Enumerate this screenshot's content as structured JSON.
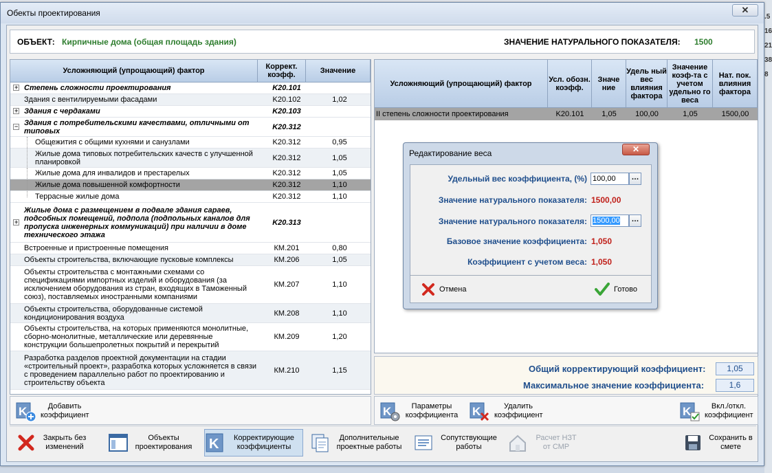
{
  "window": {
    "title": "Обекты проектирования"
  },
  "objhdr": {
    "obj_label": "ОБЪЕКТ:",
    "obj_value": "Кирпичные дома (общая площадь здания)",
    "nat_label": "ЗНАЧЕНИЕ НАТУРАЛЬНОГО ПОКАЗАТЕЛЯ:",
    "nat_value": "1500"
  },
  "left_table": {
    "headers": [
      "Усложняющий (упрощающий) фактор",
      "Коррект. коэфф.",
      "Значение"
    ],
    "rows": [
      {
        "name": "Степень сложности проектирования",
        "code": "K20.101",
        "value": ""
      },
      {
        "name": "Здания с вентилируемыми фасадами",
        "code": "K20.102",
        "value": "1,02"
      },
      {
        "name": "Здания с чердаками",
        "code": "K20.103",
        "value": ""
      },
      {
        "name": "Здания с потребительскими качествами, отличными от типовых",
        "code": "K20.312",
        "value": ""
      },
      {
        "name": "Общежития с общими кухнями и санузлами",
        "code": "K20.312",
        "value": "0,95"
      },
      {
        "name": "Жилые дома типовых потребительских качеств с улучшенной планировкой",
        "code": "K20.312",
        "value": "1,05"
      },
      {
        "name": "Жилые дома для инвалидов и престарелых",
        "code": "K20.312",
        "value": "1,05"
      },
      {
        "name": "Жилые дома повышенной комфортности",
        "code": "K20.312",
        "value": "1,10"
      },
      {
        "name": "Террасные жилые дома",
        "code": "K20.312",
        "value": "1,10"
      },
      {
        "name": "Жилые дома с размещением в подвале здания сараев, подсобных помещений, подпола (подпольных каналов для пропуска инженерных коммуникаций) при наличии в доме технического этажа",
        "code": "K20.313",
        "value": ""
      },
      {
        "name": "Встроенные и пристроенные помещения",
        "code": "КМ.201",
        "value": "0,80"
      },
      {
        "name": "Объекты строительства, включающие пусковые комплексы",
        "code": "КМ.206",
        "value": "1,05"
      },
      {
        "name": "Объекты строительства с монтажными схемами со спецификациями импортных изделий и оборудования (за исключением оборудования из стран, входящих в Таможенный союз), поставляемых иностранными компаниями",
        "code": "КМ.207",
        "value": "1,10"
      },
      {
        "name": "Объекты строительства, оборудованные системой кондиционирования воздуха",
        "code": "КМ.208",
        "value": "1,10"
      },
      {
        "name": "Объекты строительства, на которых применяются монолитные, сборно-монолитные, металлические или деревянные конструкции большепролетных покрытий и перекрытий",
        "code": "КМ.209",
        "value": "1,20"
      },
      {
        "name": "Разработка разделов проектной документации на стадии «строительный проект», разработка которых усложняется в связи с проведением параллельно работ по проектированию и строительству объекта",
        "code": "КМ.210",
        "value": "1,15"
      }
    ]
  },
  "right_table": {
    "headers": [
      "Усложняющий (упрощающий) фактор",
      "Усл. обозн. коэфф.",
      "Значе ние",
      "Удель ный вес влияния фактора",
      "Значение коэф-та с учетом удельно го веса",
      "Нат. пок. влияния фактора"
    ],
    "rows": [
      {
        "name": "II степень сложности проектирования",
        "code": "K20.101",
        "value": "1,05",
        "weight": "100,00",
        "weighted": "1,05",
        "nat": "1500,00"
      }
    ]
  },
  "summary": {
    "total_label": "Общий корректирующий коэффициент:",
    "total_value": "1,05",
    "max_label": "Максимальное значение коэффициента:",
    "max_value": "1,6"
  },
  "actions": {
    "add": "Добавить коэффициент",
    "params": "Параметры коэффициента",
    "delete": "Удалить коэффициент",
    "toggle": "Вкл./откл. коэффициент"
  },
  "toolbar": {
    "close": "Закрыть без изменений",
    "objects": "Объекты проектирования",
    "coeffs": "Корректирующие коэффициенты",
    "extra": "Дополнительные проектные работы",
    "related": "Сопутствующие работы",
    "calc": "Расчет НЗТ от СМР",
    "save": "Сохранить в смете"
  },
  "dialog": {
    "title": "Редактирование веса",
    "weight_label": "Удельный вес коэффициента, (%)",
    "weight_value": "100,00",
    "nat_label": "Значение натурального показателя:",
    "nat_value": "1500,00",
    "nat_input_label": "Значение натурального показателя:",
    "nat_input_value": "1500,00",
    "base_label": "Базовое значение коэффициента:",
    "base_value": "1,050",
    "weighted_label": "Коэффициент с учетом веса:",
    "weighted_value": "1,050",
    "cancel": "Отмена",
    "ok": "Готово"
  },
  "right_edge": [
    ".5",
    "16",
    "21",
    "38",
    "8"
  ]
}
